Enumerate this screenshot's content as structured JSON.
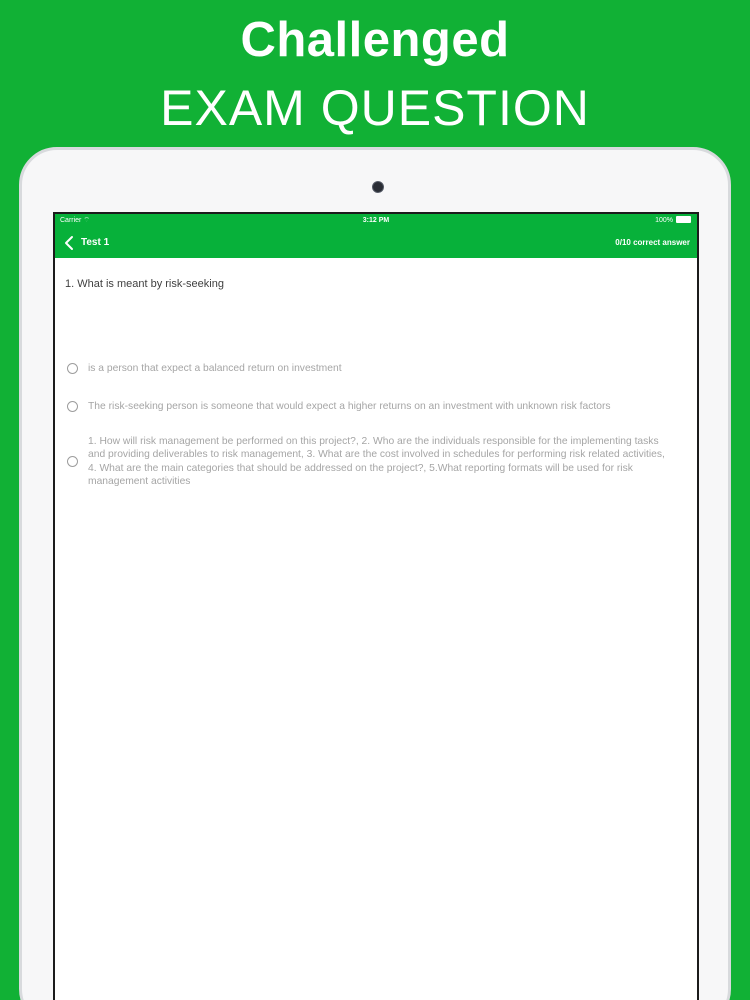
{
  "promo": {
    "title": "Challenged",
    "subtitle": "EXAM QUESTION"
  },
  "statusbar": {
    "carrier": "Carrier",
    "time": "3:12 PM",
    "battery": "100%"
  },
  "navbar": {
    "title": "Test 1",
    "score": "0/10 correct answer"
  },
  "question": {
    "text": "1. What is meant by risk-seeking"
  },
  "options": [
    {
      "label": "is a person that expect a balanced return on investment"
    },
    {
      "label": "The risk-seeking person is someone that would expect a higher returns on an investment with unknown risk factors"
    },
    {
      "label": "1. How will risk management be performed on this project?, 2. Who are the individuals responsible for the implementing tasks and providing deliverables to risk management, 3. What are the cost involved in schedules for performing risk related activities, 4. What are the main categories that should be addressed on the project?, 5.What reporting formats will be used for risk management activities"
    }
  ],
  "colors": {
    "brand": "#11b135",
    "nav": "#07b13a",
    "answer_text": "#a5a5a5"
  },
  "icons": {
    "back": "chevron-left-icon",
    "wifi": "wifi-icon",
    "battery": "battery-icon",
    "radio": "radio-icon"
  }
}
